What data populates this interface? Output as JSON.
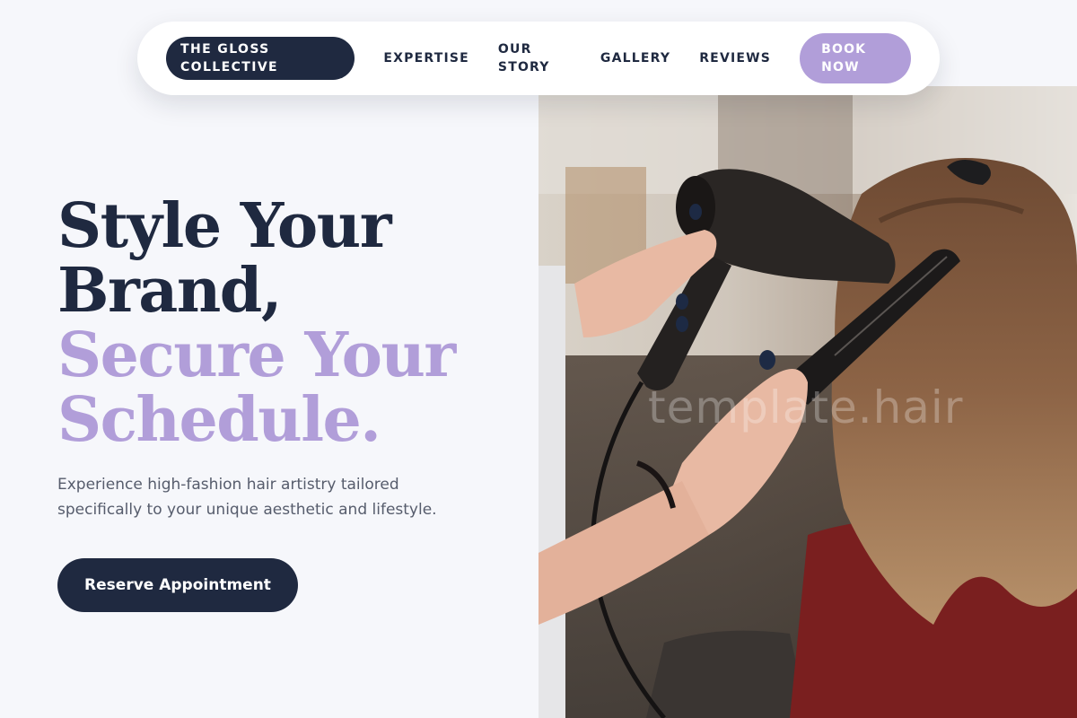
{
  "nav": {
    "brand": "THE GLOSS COLLECTIVE",
    "links": [
      {
        "label": "EXPERTISE"
      },
      {
        "label": "OUR STORY"
      },
      {
        "label": "GALLERY"
      },
      {
        "label": "REVIEWS"
      }
    ],
    "book_label": "BOOK NOW"
  },
  "hero": {
    "headline": {
      "line1": "Style Your",
      "line2": "Brand,",
      "line3": "Secure Your",
      "line4": "Schedule."
    },
    "subtext": "Experience high-fashion hair artistry tailored specifically to your unique aesthetic and lifestyle.",
    "cta_label": "Reserve Appointment",
    "photo": {
      "watermark": "template.hair"
    }
  },
  "colors": {
    "background": "#f6f7fb",
    "navy": "#1f2940",
    "lavender": "#b19ed9",
    "body_text": "#565c6c"
  }
}
